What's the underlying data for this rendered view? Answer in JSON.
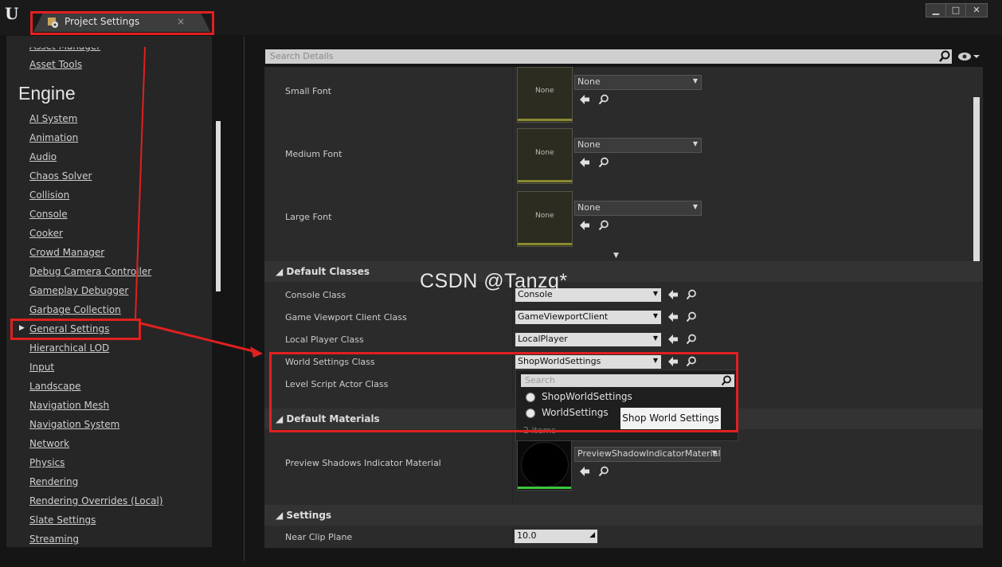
{
  "window": {
    "tab_title": "Project Settings",
    "tab_close": "×",
    "minimize": "▁",
    "maximize": "□",
    "close": "✕"
  },
  "nav": {
    "partial_item": "Asset Manager",
    "asset_tools": "Asset Tools",
    "section_title": "Engine",
    "items": [
      "AI System",
      "Animation",
      "Audio",
      "Chaos Solver",
      "Collision",
      "Console",
      "Cooker",
      "Crowd Manager",
      "Debug Camera Controller",
      "Gameplay Debugger",
      "Garbage Collection",
      "General Settings",
      "Hierarchical LOD",
      "Input",
      "Landscape",
      "Navigation Mesh",
      "Navigation System",
      "Network",
      "Physics",
      "Rendering",
      "Rendering Overrides (Local)",
      "Slate Settings",
      "Streaming"
    ],
    "selected_item": "General Settings"
  },
  "search": {
    "placeholder": "Search Details"
  },
  "fonts": {
    "rows": [
      {
        "label": "Small Font",
        "thumb": "None",
        "value": "None"
      },
      {
        "label": "Medium Font",
        "thumb": "None",
        "value": "None"
      },
      {
        "label": "Large Font",
        "thumb": "None",
        "value": "None"
      }
    ]
  },
  "default_classes": {
    "title": "Default Classes",
    "rows": [
      {
        "label": "Console Class",
        "value": "Console"
      },
      {
        "label": "Game Viewport Client Class",
        "value": "GameViewportClient"
      },
      {
        "label": "Local Player Class",
        "value": "LocalPlayer"
      },
      {
        "label": "World Settings Class",
        "value": "ShopWorldSettings"
      },
      {
        "label": "Level Script Actor Class",
        "value": ""
      }
    ]
  },
  "popup": {
    "search_placeholder": "Search",
    "options": [
      "ShopWorldSettings",
      "WorldSettings"
    ],
    "count": "2 items",
    "tooltip": "Shop World Settings"
  },
  "default_materials": {
    "title": "Default Materials",
    "rows": [
      {
        "label": "Preview Shadows Indicator Material",
        "value": "PreviewShadowIndicatorMaterial"
      }
    ]
  },
  "settings": {
    "title": "Settings",
    "rows": [
      {
        "label": "Near Clip Plane",
        "value": "10.0"
      }
    ]
  },
  "watermark": "CSDN @Tanzq*",
  "colors": {
    "annotation_red": "#e02020",
    "panel_bg": "#2b2b2b",
    "nav_bg": "#262626"
  }
}
